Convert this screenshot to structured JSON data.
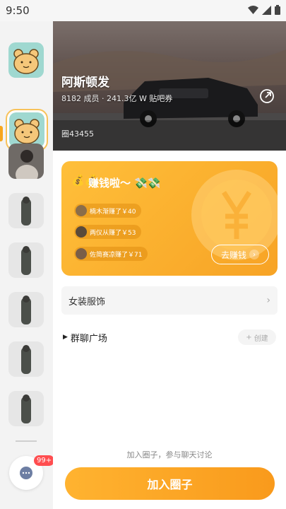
{
  "status_bar": {
    "time": "9:50",
    "icons": [
      "wifi-icon",
      "signal-icon",
      "battery-icon"
    ]
  },
  "sidebar": {
    "items": [
      {
        "type": "bear-avatar",
        "selected": false
      },
      {
        "type": "bear-avatar",
        "selected": true
      },
      {
        "type": "photo-avatar",
        "selected": false
      },
      {
        "type": "photo-avatar",
        "selected": false
      },
      {
        "type": "photo-avatar",
        "selected": false
      },
      {
        "type": "photo-avatar",
        "selected": false
      },
      {
        "type": "photo-avatar",
        "selected": false
      },
      {
        "type": "photo-avatar",
        "selected": false
      }
    ],
    "chat_badge": "99+",
    "accent_color": "#f7a61c"
  },
  "banner": {
    "title": "阿斯顿发",
    "stats": "8182 成员 · 241.3亿 W 贴吧券",
    "id_text": "圈43455"
  },
  "earn_card": {
    "title": "赚钱啦～",
    "leading_emoji": "💰💰",
    "trailing_emoji": "💸💸",
    "items": [
      "楠木渐赚了￥40",
      "两仪从赚了￥53",
      "佐简赛凉赚了￥71"
    ],
    "button_label": "去赚钱",
    "colors": {
      "start": "#ffbf3a",
      "end": "#f7a325"
    }
  },
  "category": {
    "label": "女装服饰"
  },
  "group_square": {
    "label": "群聊广场",
    "create_label": "创建"
  },
  "footer": {
    "hint": "加入圈子，参与聊天讨论",
    "join_button": "加入圈子",
    "button_color": "#f99a1c"
  }
}
